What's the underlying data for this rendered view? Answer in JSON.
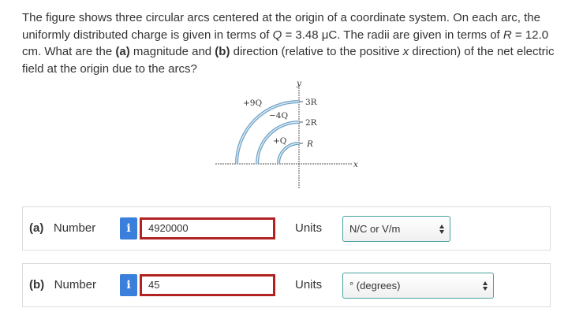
{
  "question": {
    "part1": "The figure shows three circular arcs centered at the origin of a coordinate system. On each arc, the uniformly distributed charge is given in terms of ",
    "q_symbol": "Q",
    "part2": " = 3.48 μC. The radii are given in terms of ",
    "r_symbol": "R",
    "part3": " = 12.0 cm. What are the ",
    "a_label": "(a)",
    "part4": " magnitude and ",
    "b_label": "(b)",
    "part5": " direction (relative to the positive ",
    "x_symbol": "x",
    "part6": " direction) of the net electric field at the origin due to the arcs?"
  },
  "figure": {
    "y_axis": "y",
    "x_axis": "x",
    "arc_outer_charge": "+9Q",
    "arc_middle_charge": "−4Q",
    "arc_inner_charge": "+Q",
    "radius_outer": "3R",
    "radius_middle": "2R",
    "radius_inner": "R"
  },
  "rows": [
    {
      "label_part": "(a)",
      "label_text": "Number",
      "info": "i",
      "value": "4920000",
      "units_label": "Units",
      "unit_value": "N/C or V/m"
    },
    {
      "label_part": "(b)",
      "label_text": "Number",
      "info": "i",
      "value": "45",
      "units_label": "Units",
      "unit_value": "° (degrees)"
    }
  ],
  "colors": {
    "input_border": "#b22222",
    "info_button": "#3a7fdc",
    "select_border": "#4aa3a0",
    "arc_color": "#6fa3c7"
  }
}
